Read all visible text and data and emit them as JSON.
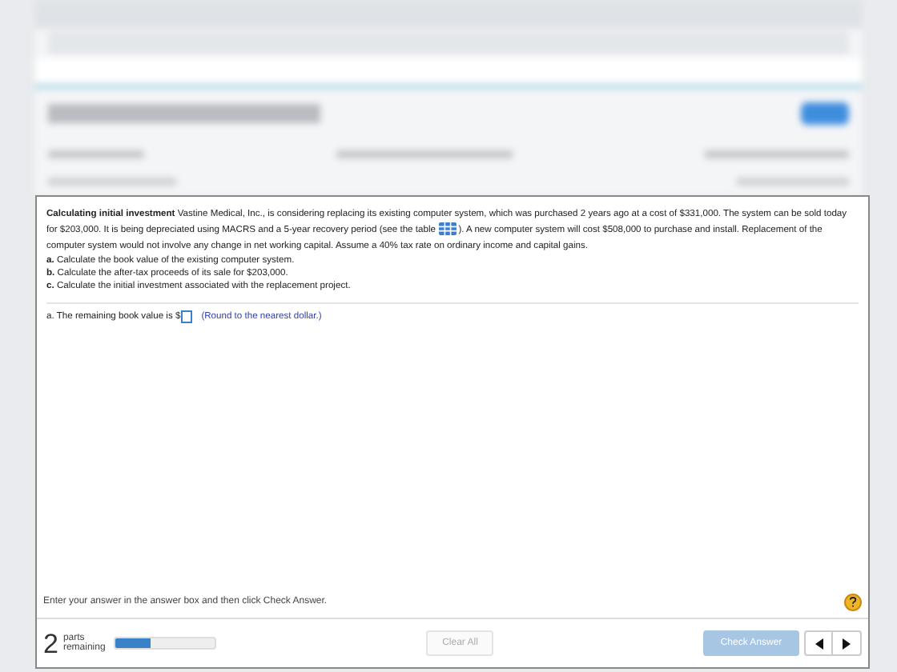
{
  "problem": {
    "title": "Calculating initial investment",
    "text": "Vastine Medical, Inc., is considering replacing its existing computer system, which was purchased 2 years ago at a cost of $331,000. The system can be sold today for $203,000. It is being depreciated using MACRS and a 5-year recovery period (see the table",
    "text_after": "). A new computer system will cost $508,000 to purchase and install. Replacement of the computer system would not involve any change in net working capital. Assume a 40% tax rate on ordinary income and capital gains.",
    "parts": [
      {
        "letter": "a.",
        "text": "Calculate the book value of the existing computer system."
      },
      {
        "letter": "b.",
        "text": "Calculate the after-tax proceeds of its sale for $203,000."
      },
      {
        "letter": "c.",
        "text": "Calculate the initial investment associated with the replacement project."
      }
    ]
  },
  "answer": {
    "label": "a. The remaining book value is $",
    "hint": "(Round to the nearest dollar.)"
  },
  "instruction": "Enter your answer in the answer box and then click Check Answer.",
  "footer": {
    "parts_count": "2",
    "parts_label": "parts remaining",
    "progress": {
      "level": 0.35
    },
    "clear_button": "Clear All",
    "check_button": "Check Answer"
  }
}
